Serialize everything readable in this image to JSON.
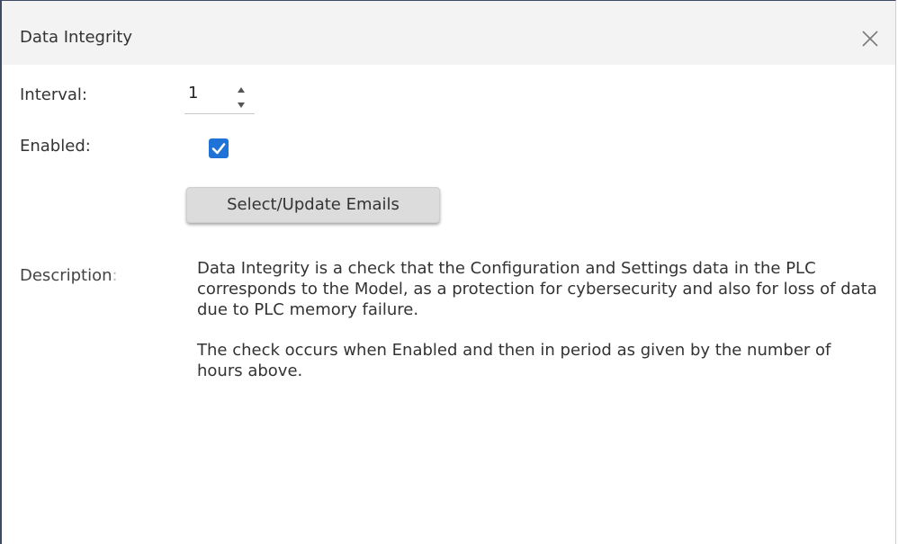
{
  "dialog": {
    "title": "Data Integrity",
    "close_icon": "close-icon"
  },
  "form": {
    "interval_label": "Interval:",
    "interval_value": "1",
    "enabled_label": "Enabled:",
    "enabled_checked": true,
    "emails_button_label": "Select/Update Emails",
    "description_label": "Description",
    "description_colon": ":",
    "description_paragraph_1": "Data Integrity is a check that the Configuration and Settings data in the PLC corresponds to the Model, as a protection for cybersecurity and also for loss of data due to PLC memory failure.",
    "description_paragraph_2": "The check occurs when Enabled and then in period as given by the number of hours above."
  },
  "colors": {
    "checkbox_accent": "#1f73d6",
    "titlebar_bg": "#f3f3f3",
    "button_bg": "#dcdcdc"
  }
}
